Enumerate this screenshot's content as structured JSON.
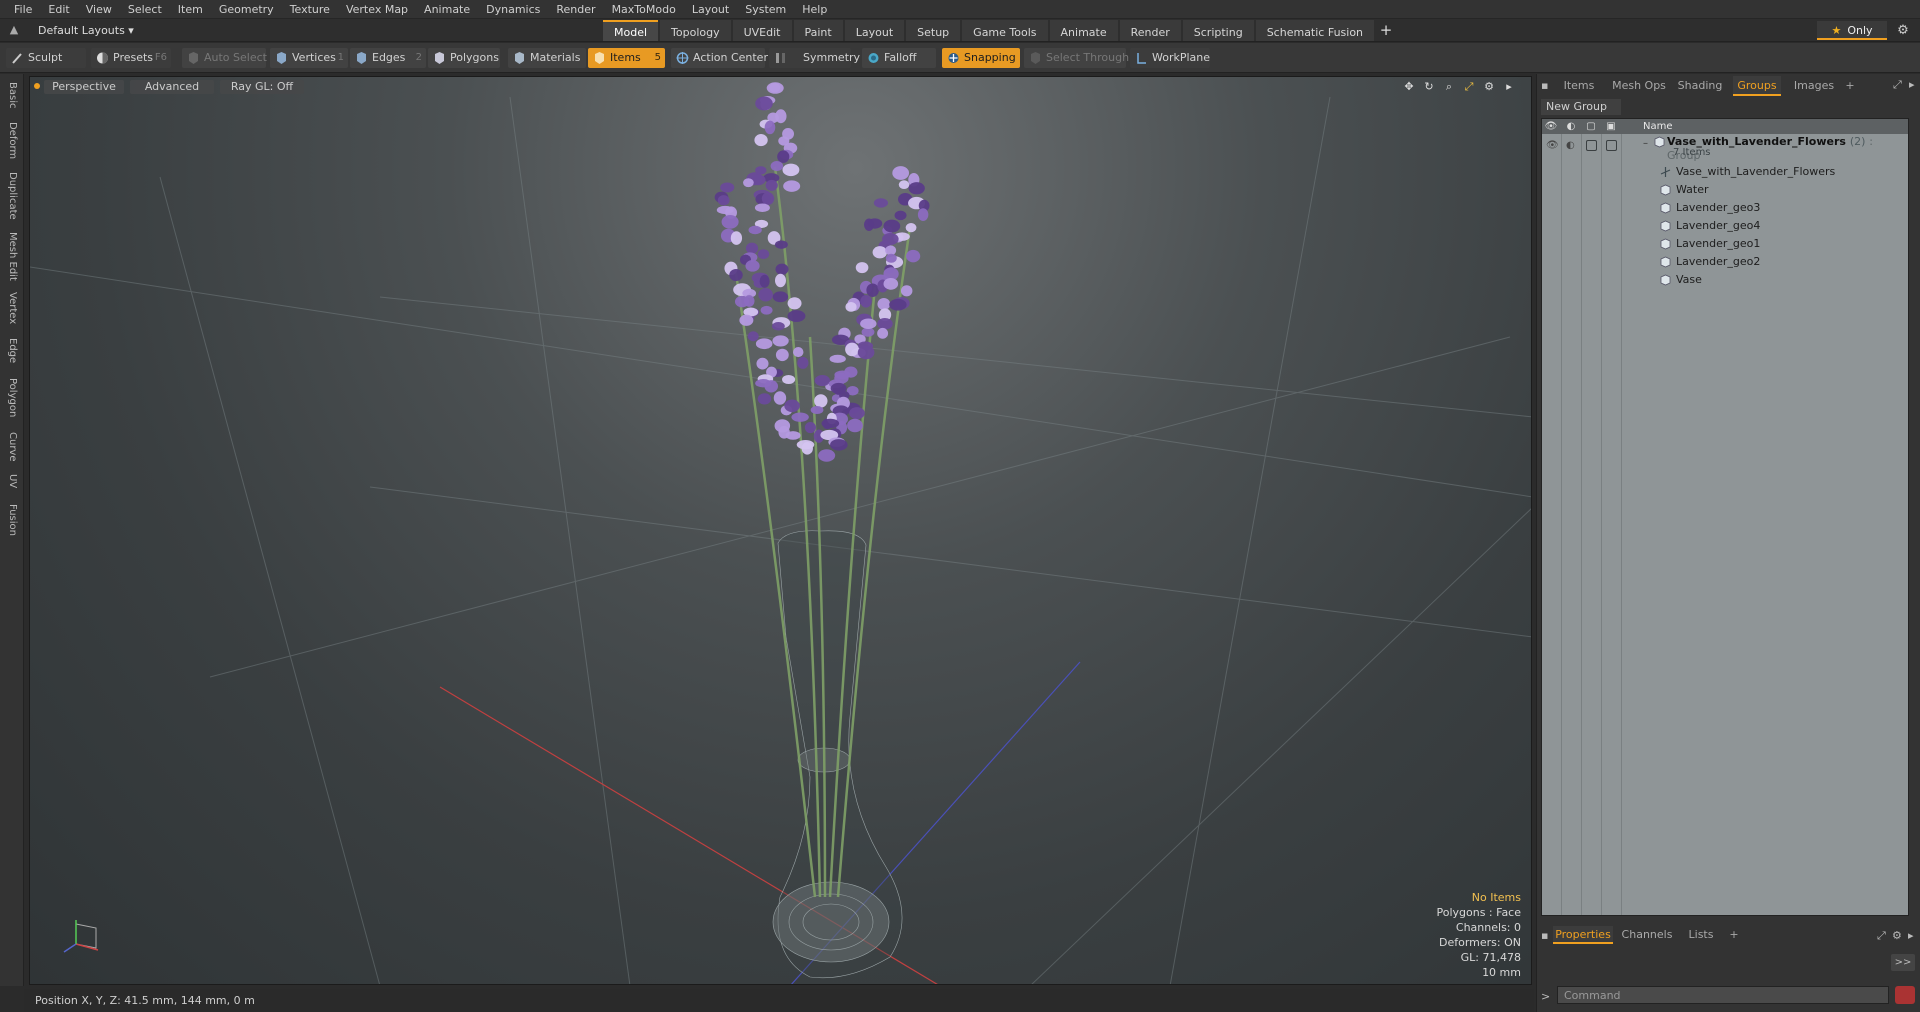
{
  "menu": [
    "File",
    "Edit",
    "View",
    "Select",
    "Item",
    "Geometry",
    "Texture",
    "Vertex Map",
    "Animate",
    "Dynamics",
    "Render",
    "MaxToModo",
    "Layout",
    "System",
    "Help"
  ],
  "layout_select": "Default Layouts ▾",
  "main_tabs": [
    "Model",
    "Topology",
    "UVEdit",
    "Paint",
    "Layout",
    "Setup",
    "Game Tools",
    "Animate",
    "Render",
    "Scripting",
    "Schematic Fusion"
  ],
  "only_label": "Only",
  "toolbar": {
    "sculpt": "Sculpt",
    "presets": "Presets",
    "presets_key": "F6",
    "auto_select": "Auto Select",
    "vertices": "Vertices",
    "vertices_key": "1",
    "edges": "Edges",
    "edges_key": "2",
    "polygons": "Polygons",
    "materials": "Materials",
    "items": "Items",
    "items_key": "5",
    "action_center": "Action Center",
    "symmetry": "Symmetry",
    "falloff": "Falloff",
    "snapping": "Snapping",
    "select_through": "Select Through",
    "workplane": "WorkPlane"
  },
  "left_tabs": [
    "Basic",
    "Deform",
    "Duplicate",
    "Mesh Edit",
    "Vertex",
    "Edge",
    "Polygon",
    "Curve",
    "UV",
    "Fusion"
  ],
  "viewport": {
    "perspective": "Perspective",
    "advanced": "Advanced",
    "raygl": "Ray GL: Off",
    "info": {
      "no_items": "No Items",
      "polygons": "Polygons : Face",
      "channels": "Channels: 0",
      "deformers": "Deformers: ON",
      "gl": "GL: 71,478",
      "scale": "10 mm"
    }
  },
  "status": "Position X, Y, Z:   41.5 mm, 144 mm, 0 m",
  "right_panel": {
    "tabs": [
      "Items",
      "Mesh Ops",
      "Shading",
      "Groups",
      "Images"
    ],
    "active_tab": "Groups",
    "new_group": "New Group",
    "name_header": "Name",
    "group": {
      "name": "Vase_with_Lavender_Flowers",
      "count": "(2)",
      "type": ": Group",
      "items_count": "7 Items"
    },
    "children": [
      "Vase_with_Lavender_Flowers",
      "Water",
      "Lavender_geo3",
      "Lavender_geo4",
      "Lavender_geo1",
      "Lavender_geo2",
      "Vase"
    ],
    "bottom_tabs": [
      "Properties",
      "Channels",
      "Lists"
    ],
    "expand": ">>",
    "command_placeholder": "Command"
  }
}
